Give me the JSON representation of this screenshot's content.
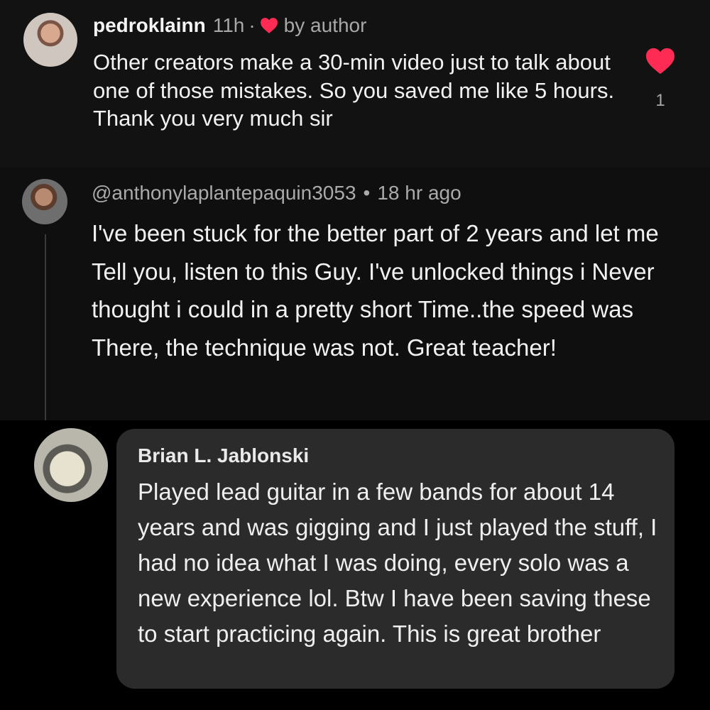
{
  "comment1": {
    "username": "pedroklainn",
    "time": "11h",
    "separator": "·",
    "by_author": "by author",
    "text": "Other creators make a 30-min video just to talk about one of those mistakes. So you saved me like 5 hours. Thank you very much sir",
    "like_count": "1",
    "icons": [
      "heart-icon"
    ],
    "heart_color": "#fe2c55"
  },
  "comment2": {
    "handle": "@anthonylaplantepaquin3053",
    "separator": "•",
    "time": "18 hr ago",
    "text": "I've been stuck for the better part of 2 years and let me Tell you, listen to this Guy. I've unlocked things i Never thought i could in a pretty short Time..the speed was There, the technique was not. Great teacher!"
  },
  "comment3": {
    "name": "Brian L. Jablonski",
    "text": "Played lead guitar in a few bands for about 14 years and was gigging and I just played the stuff, I had no idea what I was doing, every solo was a new experience lol. Btw I have been saving these to start practicing again. This is great brother"
  }
}
